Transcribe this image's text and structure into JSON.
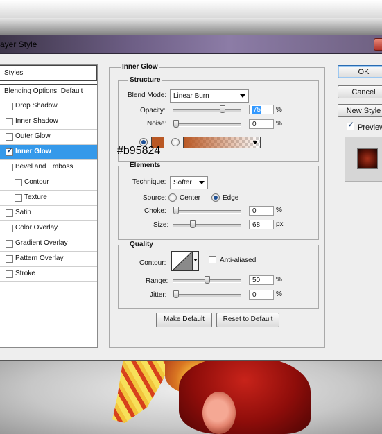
{
  "window": {
    "title": "ayer Style"
  },
  "styles_panel": {
    "header": "Styles",
    "blending_options": "Blending Options: Default",
    "items": [
      {
        "label": "Drop Shadow",
        "checked": false,
        "selected": false,
        "sub": false
      },
      {
        "label": "Inner Shadow",
        "checked": false,
        "selected": false,
        "sub": false
      },
      {
        "label": "Outer Glow",
        "checked": false,
        "selected": false,
        "sub": false
      },
      {
        "label": "Inner Glow",
        "checked": true,
        "selected": true,
        "sub": false
      },
      {
        "label": "Bevel and Emboss",
        "checked": false,
        "selected": false,
        "sub": false
      },
      {
        "label": "Contour",
        "checked": false,
        "selected": false,
        "sub": true
      },
      {
        "label": "Texture",
        "checked": false,
        "selected": false,
        "sub": true
      },
      {
        "label": "Satin",
        "checked": false,
        "selected": false,
        "sub": false
      },
      {
        "label": "Color Overlay",
        "checked": false,
        "selected": false,
        "sub": false
      },
      {
        "label": "Gradient Overlay",
        "checked": false,
        "selected": false,
        "sub": false
      },
      {
        "label": "Pattern Overlay",
        "checked": false,
        "selected": false,
        "sub": false
      },
      {
        "label": "Stroke",
        "checked": false,
        "selected": false,
        "sub": false
      }
    ]
  },
  "inner_glow": {
    "title": "Inner Glow",
    "structure": {
      "title": "Structure",
      "blend_mode_label": "Blend Mode:",
      "blend_mode_value": "Linear Burn",
      "opacity_label": "Opacity:",
      "opacity_value": "75",
      "opacity_level": 0.75,
      "noise_label": "Noise:",
      "noise_value": "0",
      "noise_level": 0,
      "percent": "%",
      "color_hex": "#b95824",
      "color_label": "#b95824"
    },
    "elements": {
      "title": "Elements",
      "technique_label": "Technique:",
      "technique_value": "Softer",
      "source_label": "Source:",
      "source_center": "Center",
      "source_edge": "Edge",
      "choke_label": "Choke:",
      "choke_value": "0",
      "choke_level": 0,
      "size_label": "Size:",
      "size_value": "68",
      "size_level": 0.27,
      "px": "px"
    },
    "quality": {
      "title": "Quality",
      "contour_label": "Contour:",
      "anti_aliased_label": "Anti-aliased",
      "range_label": "Range:",
      "range_value": "50",
      "range_level": 0.5,
      "jitter_label": "Jitter:",
      "jitter_value": "0",
      "jitter_level": 0
    },
    "make_default": "Make Default",
    "reset_default": "Reset to Default"
  },
  "buttons": {
    "ok": "OK",
    "cancel": "Cancel",
    "new_style": "New Style",
    "preview": "Preview"
  }
}
